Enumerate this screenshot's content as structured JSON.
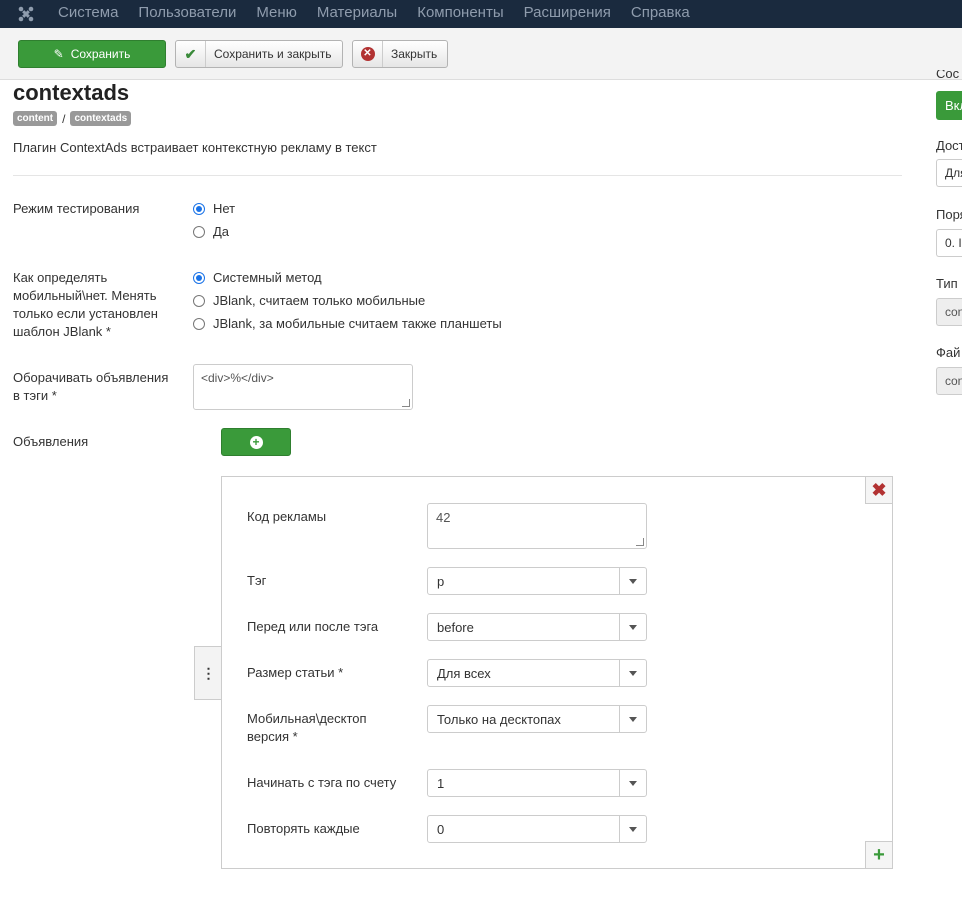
{
  "navbar": {
    "logo_icon": "joomla-icon",
    "menu": [
      "Система",
      "Пользователи",
      "Меню",
      "Материалы",
      "Компоненты",
      "Расширения",
      "Справка"
    ]
  },
  "toolbar": {
    "save_label": "Сохранить",
    "save_close_label": "Сохранить и закрыть",
    "close_label": "Закрыть"
  },
  "header": {
    "title": "contextads",
    "breadcrumb": [
      "content",
      "contextads"
    ],
    "breadcrumb_sep": "/",
    "description": "Плагин ContextAds встраивает контекстную рекламу в текст"
  },
  "form": {
    "test_mode": {
      "label": "Режим тестирования",
      "options": [
        "Нет",
        "Да"
      ],
      "selected": 0
    },
    "mobile_detect": {
      "label": "Как определять мобильный\\нет. Менять только если установлен шаблон JBlank *",
      "options": [
        "Системный метод",
        "JBlank, считаем только мобильные",
        "JBlank, за мобильные считаем также планшеты"
      ],
      "selected": 0
    },
    "wrap_tags": {
      "label": "Оборачивать объявления в тэги *",
      "value": "<div>%</div>"
    },
    "ads_label": "Объявления"
  },
  "ad_item": {
    "code": {
      "label": "Код рекламы",
      "value": "42"
    },
    "tag": {
      "label": "Тэг",
      "value": "p"
    },
    "position": {
      "label": "Перед или после тэга",
      "value": "before"
    },
    "article_size": {
      "label": "Размер статьи *",
      "value": "Для всех"
    },
    "device": {
      "label": "Мобильная\\десктоп версия *",
      "value": "Только на десктопах"
    },
    "start_from": {
      "label": "Начинать с тэга по счету",
      "value": "1"
    },
    "repeat_every": {
      "label": "Повторять каждые",
      "value": "0"
    }
  },
  "sidebar": {
    "status_label": "Сос",
    "status_button": "Вкл",
    "access_label": "Дост",
    "access_value": "Для",
    "order_label": "Поря",
    "order_value": "0. I",
    "type_label": "Тип",
    "type_value": "con",
    "file_label": "Фай",
    "file_value": "con"
  },
  "colors": {
    "navbar_bg": "#1a2a3e",
    "save_green": "#3a9a3a",
    "remove_red": "#b23232",
    "radio_blue": "#1a73e8"
  }
}
